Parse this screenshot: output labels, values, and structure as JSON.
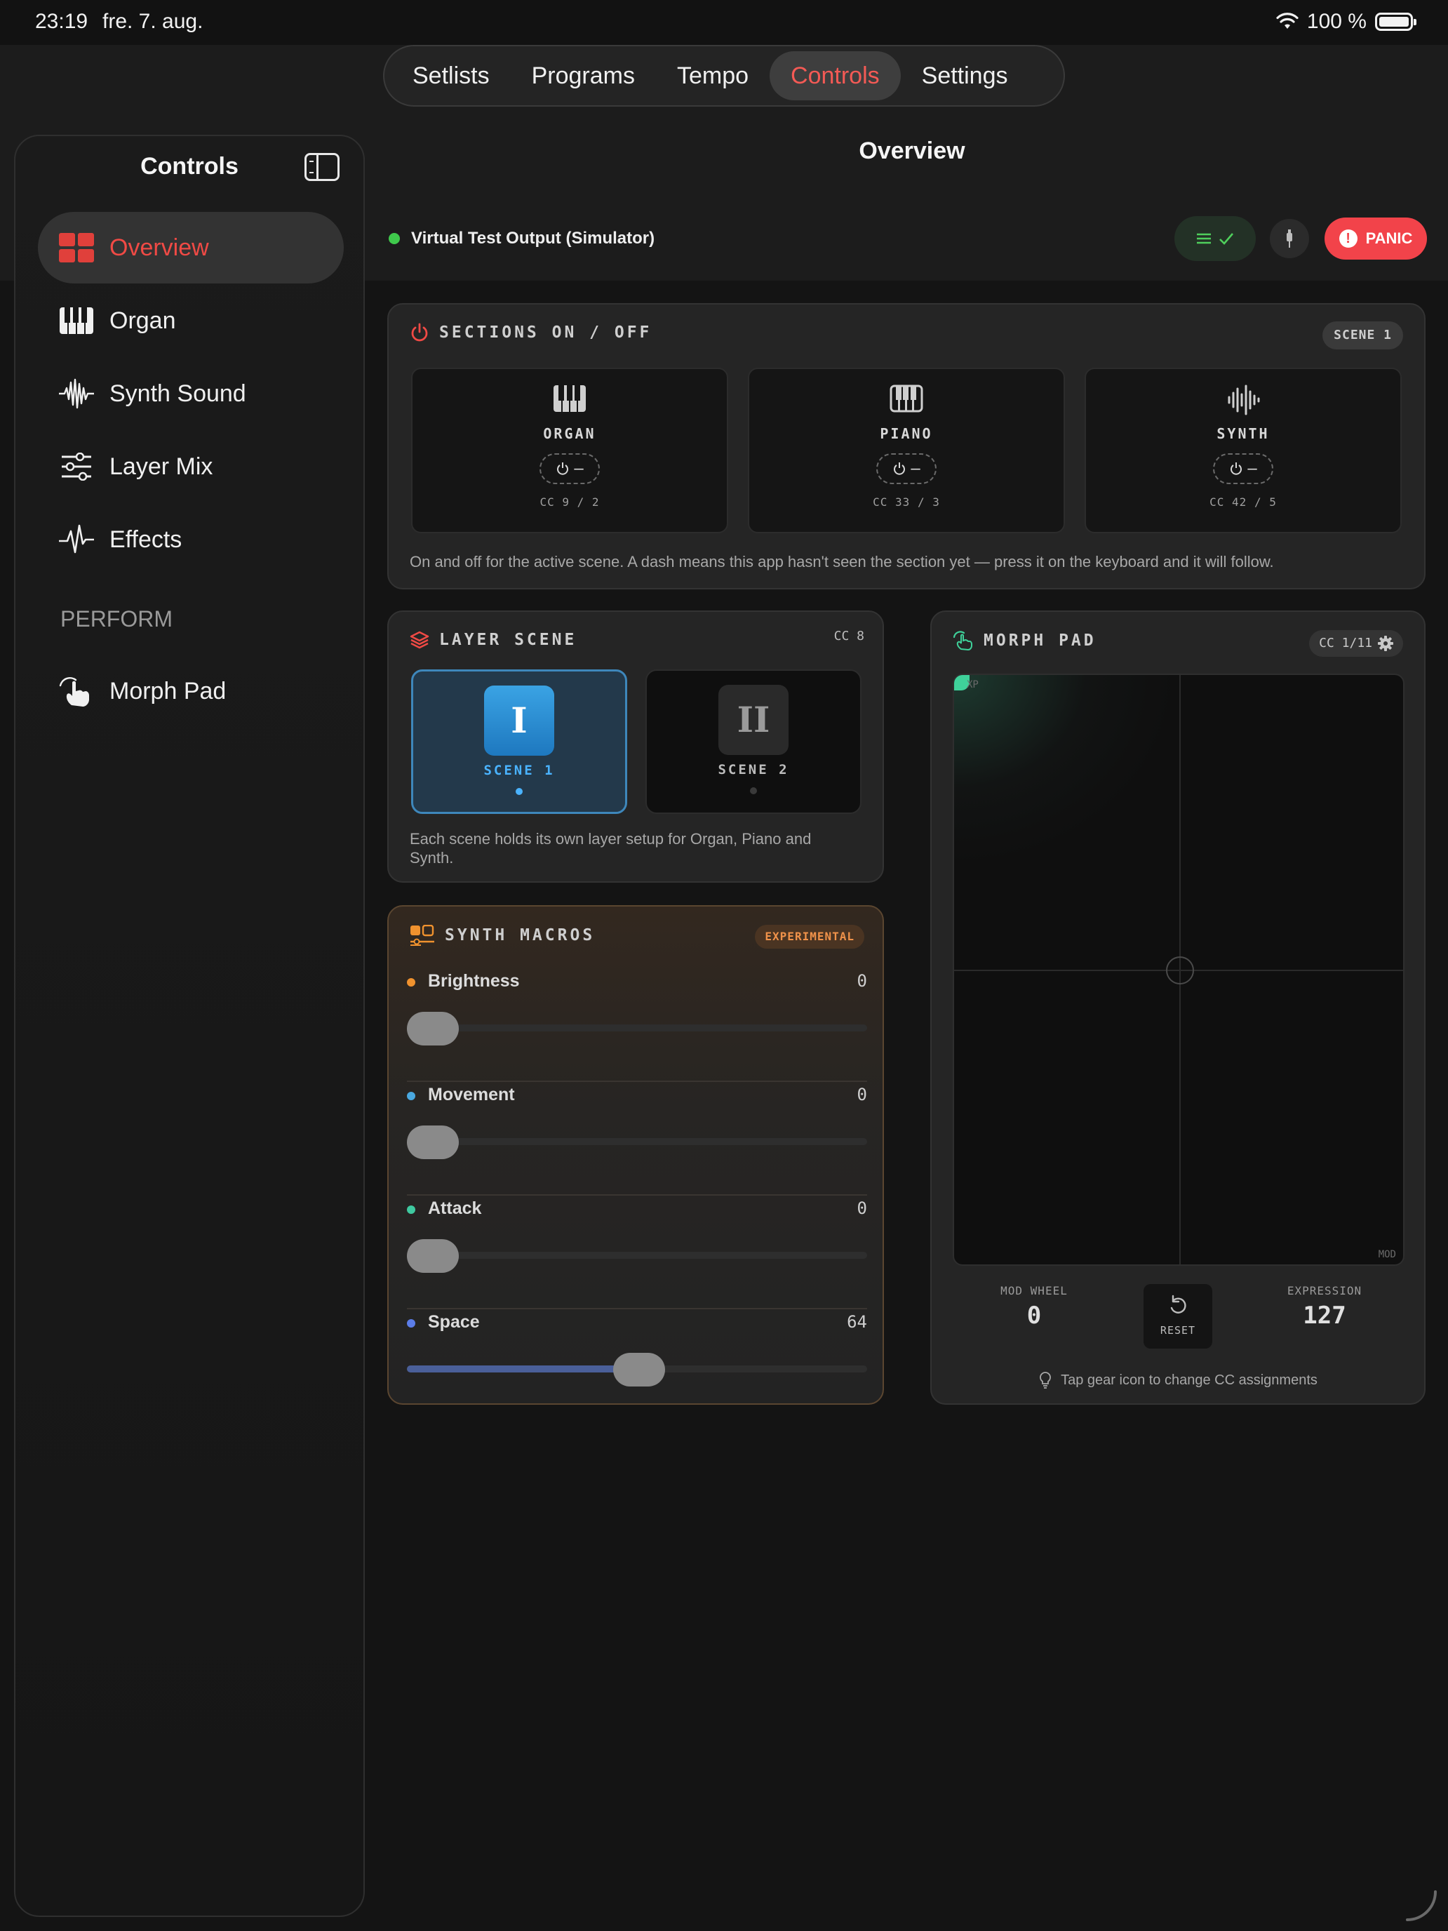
{
  "status_bar": {
    "time": "23:19",
    "date": "fre. 7. aug.",
    "battery": "100 %"
  },
  "tabs": [
    {
      "label": "Setlists",
      "active": false
    },
    {
      "label": "Programs",
      "active": false
    },
    {
      "label": "Tempo",
      "active": false
    },
    {
      "label": "Controls",
      "active": true
    },
    {
      "label": "Settings",
      "active": false
    }
  ],
  "sidebar": {
    "title": "Controls",
    "items": [
      {
        "label": "Overview",
        "icon": "grid-icon",
        "active": true
      },
      {
        "label": "Organ",
        "icon": "piano-keys-icon",
        "active": false
      },
      {
        "label": "Synth Sound",
        "icon": "waveform-icon",
        "active": false
      },
      {
        "label": "Layer Mix",
        "icon": "sliders-icon",
        "active": false
      },
      {
        "label": "Effects",
        "icon": "pulse-icon",
        "active": false
      }
    ],
    "section_label": "PERFORM",
    "perform_items": [
      {
        "label": "Morph Pad",
        "icon": "hand-touch-icon"
      }
    ]
  },
  "main": {
    "title": "Overview",
    "device": {
      "name": "Virtual Test Output (Simulator)",
      "connected": true
    },
    "panic_label": "PANIC"
  },
  "sections": {
    "title": "SECTIONS ON / OFF",
    "scene_badge": "SCENE 1",
    "tiles": [
      {
        "name": "ORGAN",
        "state": "–",
        "cc": "CC 9 / 2"
      },
      {
        "name": "PIANO",
        "state": "–",
        "cc": "CC 33 / 3"
      },
      {
        "name": "SYNTH",
        "state": "–",
        "cc": "CC 42 / 5"
      }
    ],
    "note": "On and off for the active scene. A dash means this app hasn't seen the section yet — press it on the keyboard and it will follow."
  },
  "layer_scene": {
    "title": "LAYER SCENE",
    "cc": "CC 8",
    "scenes": [
      {
        "numeral": "I",
        "label": "SCENE 1",
        "active": true
      },
      {
        "numeral": "II",
        "label": "SCENE 2",
        "active": false
      }
    ],
    "note": "Each scene holds its own layer setup for Organ, Piano and Synth."
  },
  "synth_macros": {
    "title": "SYNTH MACROS",
    "badge": "EXPERIMENTAL",
    "macros": [
      {
        "name": "Brightness",
        "value": "0",
        "level": 0,
        "color": "#f0922e"
      },
      {
        "name": "Movement",
        "value": "0",
        "level": 0,
        "color": "#4aa8e0"
      },
      {
        "name": "Attack",
        "value": "0",
        "level": 0,
        "color": "#3fc9a0"
      },
      {
        "name": "Space",
        "value": "64",
        "level": 0.504,
        "color": "#5b7de8"
      }
    ]
  },
  "morph_pad": {
    "title": "MORPH PAD",
    "cc": "CC 1/11",
    "x_label": "XP",
    "y_label": "MOD",
    "mod_wheel_label": "MOD WHEEL",
    "mod_wheel_value": "0",
    "reset_label": "RESET",
    "expression_label": "EXPRESSION",
    "expression_value": "127",
    "tip": "Tap gear icon to change CC assignments"
  },
  "colors": {
    "accent_red": "#f04a45",
    "panic": "#f2434a",
    "scene_blue": "#3aa3e4",
    "experimental_orange": "#f0924a",
    "morph_green": "#3fd19a"
  }
}
